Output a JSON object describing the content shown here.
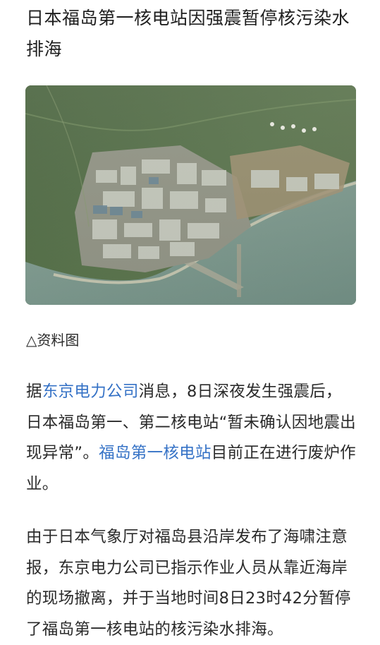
{
  "article": {
    "title": "日本福岛第一核电站因强震暂停核污染水排海",
    "image_caption": "△资料图",
    "paragraph1": {
      "before_link1": "据",
      "link1": "东京电力公司",
      "middle": "消息，8日深夜发生强震后，日本福岛第一、第二核电站“暂未确认因地震出现异常”。",
      "link2": "福岛第一核电站",
      "after": "目前正在进行废炉作业。"
    },
    "paragraph2": "由于日本气象厅对福岛县沿岸发布了海啸注意报，东京电力公司已指示作业人员从靠近海岸的现场撤离，并于当地时间8日23时42分暂停了福岛第一核电站的核污染水排海。"
  },
  "colors": {
    "link": "#3572c6",
    "text": "#2a2a2a"
  }
}
